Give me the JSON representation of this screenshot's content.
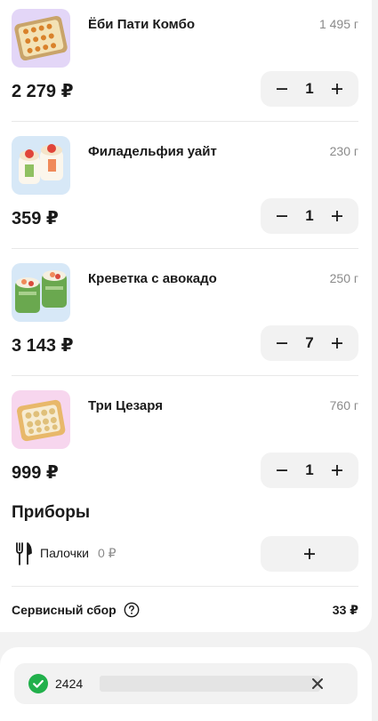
{
  "cart": {
    "items": [
      {
        "name": "Ёби Пати Комбо",
        "weight": "1 495 г",
        "price": "2 279 ₽",
        "qty": "1",
        "image": "sushi-set-platter",
        "thumb_color": "#e3d6f7"
      },
      {
        "name": "Филадельфия уайт",
        "weight": "230 г",
        "price": "359 ₽",
        "qty": "1",
        "image": "philadelphia-roll",
        "thumb_color": "#d7e8f7"
      },
      {
        "name": "Креветка с авокадо",
        "weight": "250 г",
        "price": "3 143 ₽",
        "qty": "7",
        "image": "shrimp-avocado-roll",
        "thumb_color": "#d7e8f7"
      },
      {
        "name": "Три Цезаря",
        "weight": "760 г",
        "price": "999 ₽",
        "qty": "1",
        "image": "caesar-roll-set",
        "thumb_color": "#f7d6ee"
      }
    ]
  },
  "cutlery": {
    "title": "Приборы",
    "label": "Палочки",
    "price": "0 ₽",
    "icon": "fork-icon"
  },
  "service_fee": {
    "label": "Сервисный сбор",
    "value": "33 ₽",
    "icon": "help-icon"
  },
  "promo": {
    "code": "2424",
    "status_icon": "check-circle-icon",
    "clear_icon": "close-icon"
  },
  "colors": {
    "accent_green": "#21b04b",
    "page_bg": "#f2f2f2",
    "card_bg": "#ffffff",
    "secondary_text": "#8a8a8a"
  }
}
